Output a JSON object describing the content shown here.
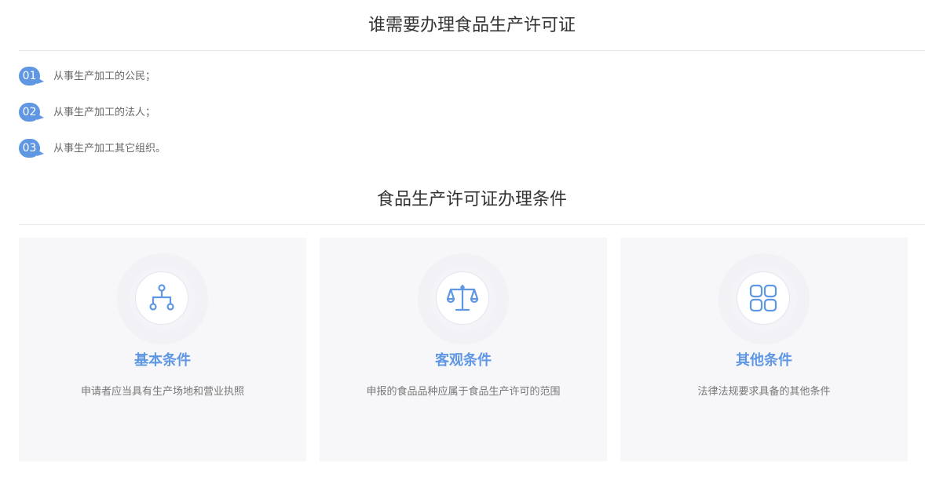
{
  "section1": {
    "title": "谁需要办理食品生产许可证",
    "items": [
      {
        "num": "01",
        "text": "从事生产加工的公民；"
      },
      {
        "num": "02",
        "text": "从事生产加工的法人；"
      },
      {
        "num": "03",
        "text": "从事生产加工其它组织。"
      }
    ]
  },
  "section2": {
    "title": "食品生产许可证办理条件",
    "cards": [
      {
        "icon": "hierarchy-icon",
        "title": "基本条件",
        "desc": "申请者应当具有生产场地和营业执照"
      },
      {
        "icon": "scale-icon",
        "title": "客观条件",
        "desc": "申报的食品品种应属于食品生产许可的范围"
      },
      {
        "icon": "grid-icon",
        "title": "其他条件",
        "desc": "法律法规要求具备的其他条件"
      }
    ]
  },
  "colors": {
    "accent": "#5f97e3",
    "card_bg": "#f7f7fa",
    "title_text": "#333333",
    "body_text": "#666666"
  }
}
